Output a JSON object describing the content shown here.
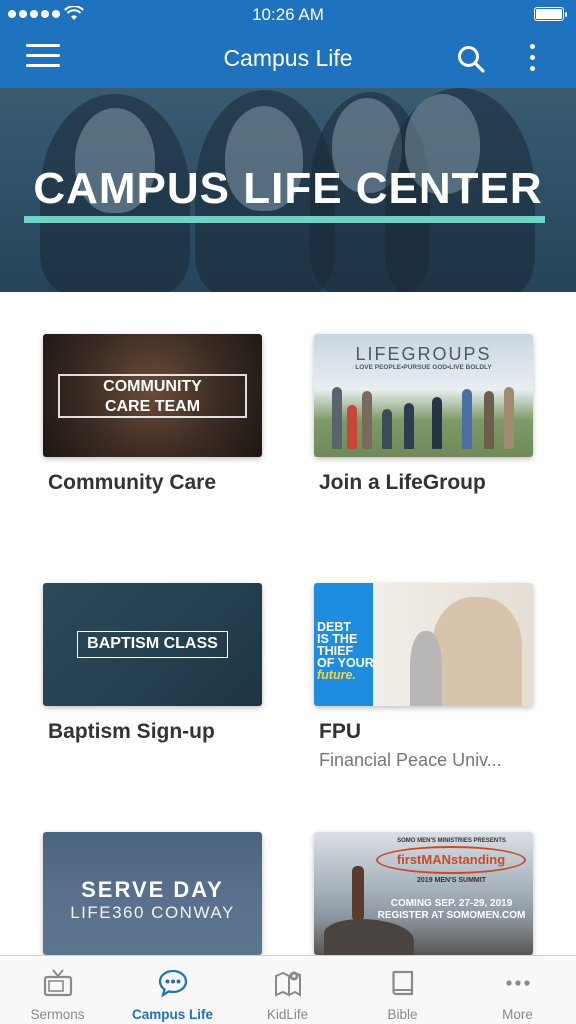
{
  "status_bar": {
    "time": "10:26 AM"
  },
  "nav": {
    "title": "Campus Life"
  },
  "hero": {
    "title": "CAMPUS LIFE CENTER"
  },
  "cards": [
    {
      "title": "Community Care",
      "subtitle": "",
      "thumb_lines": [
        "COMMUNITY",
        "CARE TEAM"
      ]
    },
    {
      "title": "Join a LifeGroup",
      "subtitle": "",
      "thumb_logo": "LIFEGROUPS",
      "thumb_tag": "LOVE PEOPLE•PURSUE GOD•LIVE BOLDLY"
    },
    {
      "title": "Baptism Sign-up",
      "subtitle": "",
      "thumb_text": "BAPTISM CLASS"
    },
    {
      "title": "FPU",
      "subtitle": "Financial Peace Univ...",
      "thumb_lines": [
        "DEBT",
        "IS THE",
        "THIEF",
        "OF YOUR",
        "future."
      ]
    },
    {
      "title": "",
      "subtitle": "",
      "thumb_lines": [
        "SERVE DAY",
        "LIFE360 CONWAY"
      ]
    },
    {
      "title": "",
      "subtitle": "",
      "thumb_presents": "SOMO MEN'S MINISTRIES PRESENTS",
      "thumb_brand": "firstMANstanding",
      "thumb_summit": "2019 MEN'S SUMMIT",
      "thumb_lines": [
        "COMING SEP. 27-29, 2019",
        "REGISTER AT SOMOMEN.COM"
      ]
    }
  ],
  "tabs": [
    {
      "label": "Sermons",
      "icon": "tv-icon",
      "active": false
    },
    {
      "label": "Campus Life",
      "icon": "chat-bubble-icon",
      "active": true
    },
    {
      "label": "KidLife",
      "icon": "map-pin-icon",
      "active": false
    },
    {
      "label": "Bible",
      "icon": "book-icon",
      "active": false
    },
    {
      "label": "More",
      "icon": "more-dots-icon",
      "active": false
    }
  ],
  "colors": {
    "brand_blue": "#1f72bd",
    "accent_teal": "#6fd2c4",
    "inactive_gray": "#8a8a8a"
  }
}
